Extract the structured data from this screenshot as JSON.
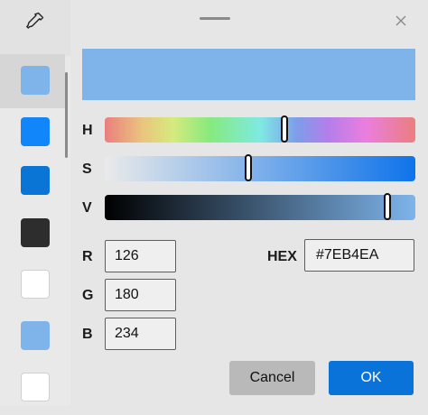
{
  "palette": {
    "eyedropper_icon": "eyedropper-icon",
    "swatches": [
      {
        "color": "#7eb4ea",
        "selected": true
      },
      {
        "color": "#1185fa",
        "selected": false
      },
      {
        "color": "#0b75d6",
        "selected": false
      },
      {
        "color": "#2d2d2d",
        "selected": false
      },
      {
        "color": "#ffffff",
        "selected": false
      },
      {
        "color": "#7eb4ea",
        "selected": false
      },
      {
        "color": "#ffffff",
        "selected": false
      }
    ]
  },
  "header": {
    "close_icon": "close-icon"
  },
  "preview": {
    "color": "#7EB4EA"
  },
  "sliders": {
    "h": {
      "label": "H",
      "value_fraction": 0.58
    },
    "s": {
      "label": "S",
      "value_fraction": 0.46
    },
    "v": {
      "label": "V",
      "value_fraction": 0.92
    }
  },
  "fields": {
    "r": {
      "label": "R",
      "value": "126"
    },
    "g": {
      "label": "G",
      "value": "180"
    },
    "b": {
      "label": "B",
      "value": "234"
    },
    "hex": {
      "label": "HEX",
      "value": "#7EB4EA"
    }
  },
  "buttons": {
    "cancel": "Cancel",
    "ok": "OK"
  }
}
